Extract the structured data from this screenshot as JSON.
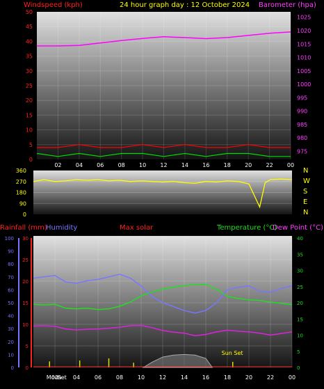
{
  "chart_data": [
    {
      "type": "line",
      "title": "24 hour graph day : 12 October 2024",
      "y_left_label": "Windspeed (kph)",
      "y_right_label": "Barometer (hpa)",
      "x_ticks": [
        "02",
        "04",
        "06",
        "08",
        "10",
        "12",
        "14",
        "16",
        "18",
        "20",
        "22",
        "00"
      ],
      "x_hours": [
        2,
        4,
        6,
        8,
        10,
        12,
        14,
        16,
        18,
        20,
        22,
        24
      ],
      "y_left_ticks": [
        0,
        5,
        10,
        15,
        20,
        25,
        30,
        35,
        40,
        45,
        50
      ],
      "y_left_range": [
        0,
        50
      ],
      "y_right_ticks": [
        975,
        980,
        985,
        990,
        995,
        1000,
        1005,
        1010,
        1015,
        1020,
        1025
      ],
      "y_right_range": [
        972,
        1027
      ],
      "colors": {
        "wind": "#ff0000",
        "barometer": "#ff00ff",
        "gust": "#ffffff",
        "avgwind": "#00dd00"
      },
      "series": [
        {
          "name": "Barometer",
          "axis": "right",
          "x": [
            0,
            2,
            4,
            6,
            8,
            10,
            12,
            14,
            16,
            18,
            20,
            22,
            24
          ],
          "values": [
            1014.3,
            1014.3,
            1014.5,
            1015.4,
            1016.3,
            1017.1,
            1017.7,
            1017.4,
            1017.0,
            1017.4,
            1018.2,
            1019.0,
            1019.5
          ]
        },
        {
          "name": "Wind speed",
          "axis": "left",
          "x": [
            0,
            2,
            4,
            6,
            8,
            10,
            12,
            14,
            16,
            18,
            20,
            22,
            24
          ],
          "values": [
            4,
            4,
            5,
            4,
            4,
            5,
            4,
            5,
            4,
            4,
            5,
            4,
            4
          ]
        },
        {
          "name": "Average wind",
          "axis": "left",
          "x": [
            0,
            2,
            4,
            6,
            8,
            10,
            12,
            14,
            16,
            18,
            20,
            22,
            24
          ],
          "values": [
            2,
            1,
            2,
            1,
            2,
            2,
            1,
            2,
            1,
            2,
            2,
            1,
            1
          ]
        }
      ]
    },
    {
      "type": "scatter",
      "y_ticks": [
        "360",
        "270",
        "180",
        "90",
        "0"
      ],
      "y_tick_values": [
        360,
        270,
        180,
        90,
        0
      ],
      "direction_labels": [
        "N",
        "W",
        "S",
        "E",
        "N"
      ],
      "y_range": [
        0,
        360
      ],
      "color": "#ffff00",
      "series": [
        {
          "name": "Wind direction",
          "x": [
            0,
            1,
            2,
            3,
            4,
            5,
            6,
            7,
            8,
            9,
            10,
            11,
            12,
            13,
            14,
            15,
            16,
            17,
            18,
            19,
            20,
            21,
            21.5,
            22,
            23,
            24
          ],
          "values": [
            270,
            285,
            270,
            275,
            285,
            280,
            285,
            275,
            280,
            270,
            275,
            270,
            265,
            270,
            260,
            255,
            270,
            265,
            275,
            270,
            250,
            60,
            260,
            285,
            290,
            285
          ]
        }
      ]
    },
    {
      "type": "line",
      "header_labels": {
        "rain": "Rainfall (mm)",
        "humidity": "Humidity",
        "solar": "Max solar",
        "temperature": "Temperature (°C)",
        "dewpoint": "Dew Point (°C)"
      },
      "x_ticks": [
        "02",
        "04",
        "06",
        "08",
        "10",
        "12",
        "14",
        "16",
        "18",
        "20",
        "22",
        "00"
      ],
      "x_hours": [
        2,
        4,
        6,
        8,
        10,
        12,
        14,
        16,
        18,
        20,
        22,
        24
      ],
      "humidity_ticks": [
        0,
        10,
        20,
        30,
        40,
        50,
        60,
        70,
        80,
        90,
        100
      ],
      "rain_ticks": [
        0,
        5,
        10,
        15,
        20,
        25,
        30
      ],
      "temp_ticks": [
        0,
        5,
        10,
        15,
        20,
        25,
        30,
        35,
        40
      ],
      "humidity_range": [
        0,
        100
      ],
      "rain_range": [
        0,
        30
      ],
      "temp_range": [
        0,
        40
      ],
      "annotations": {
        "moon": "Moon",
        "sunset": "Sun Set",
        "moon_set": "Set"
      },
      "annotation_hours": {
        "moon": 1.4,
        "moon_set": 2.3,
        "sunset": 18.3
      },
      "colors": {
        "humidity": "#7777ff",
        "temperature": "#22dd22",
        "dewpoint": "#dd22dd",
        "solar": "#aaaaaa",
        "rain": "#dddd00"
      },
      "series": [
        {
          "name": "Humidity",
          "axis": "humidity",
          "x": [
            0,
            1,
            2,
            3,
            4,
            5,
            6,
            7,
            8,
            9,
            10,
            11,
            12,
            13,
            14,
            15,
            16,
            17,
            18,
            19,
            20,
            21,
            22,
            23,
            24
          ],
          "values": [
            69,
            70,
            71,
            66,
            65,
            67,
            68,
            70,
            72,
            69,
            63,
            55,
            50,
            47,
            44,
            42,
            44,
            50,
            60,
            62,
            63,
            59,
            58,
            61,
            63
          ]
        },
        {
          "name": "Temperature",
          "axis": "temp",
          "x": [
            0,
            1,
            2,
            3,
            4,
            5,
            6,
            7,
            8,
            9,
            10,
            11,
            12,
            13,
            14,
            15,
            16,
            17,
            18,
            19,
            20,
            21,
            22,
            23,
            24
          ],
          "values": [
            19.5,
            19.3,
            19.5,
            18.3,
            18.1,
            18.3,
            17.9,
            18.1,
            18.9,
            20.2,
            22.1,
            23.3,
            24.2,
            24.8,
            25.3,
            25.6,
            25.7,
            24.1,
            22.0,
            21.3,
            20.9,
            20.7,
            20.2,
            19.8,
            19.4
          ]
        },
        {
          "name": "Dew Point",
          "axis": "temp",
          "x": [
            0,
            1,
            2,
            3,
            4,
            5,
            6,
            7,
            8,
            9,
            10,
            11,
            12,
            13,
            14,
            15,
            16,
            17,
            18,
            19,
            20,
            21,
            22,
            23,
            24
          ],
          "values": [
            12.8,
            12.9,
            12.7,
            11.9,
            11.6,
            11.8,
            11.9,
            12.1,
            12.4,
            12.9,
            13.0,
            12.3,
            11.4,
            10.9,
            10.6,
            9.8,
            10.2,
            11.0,
            11.5,
            11.2,
            11.0,
            10.6,
            10.0,
            10.5,
            11.0
          ]
        },
        {
          "name": "Max solar",
          "axis": "humidity",
          "x": [
            10.2,
            11,
            12,
            13,
            14,
            15,
            16,
            16.6
          ],
          "values": [
            0,
            4,
            8,
            9.5,
            10,
            9.5,
            7,
            0
          ]
        },
        {
          "name": "Rainfall",
          "axis": "rain",
          "x": [
            1.5,
            4.3,
            7.0,
            9.3,
            18.5
          ],
          "values": [
            1.4,
            1.6,
            2.1,
            1.1,
            1.3
          ]
        }
      ]
    }
  ]
}
